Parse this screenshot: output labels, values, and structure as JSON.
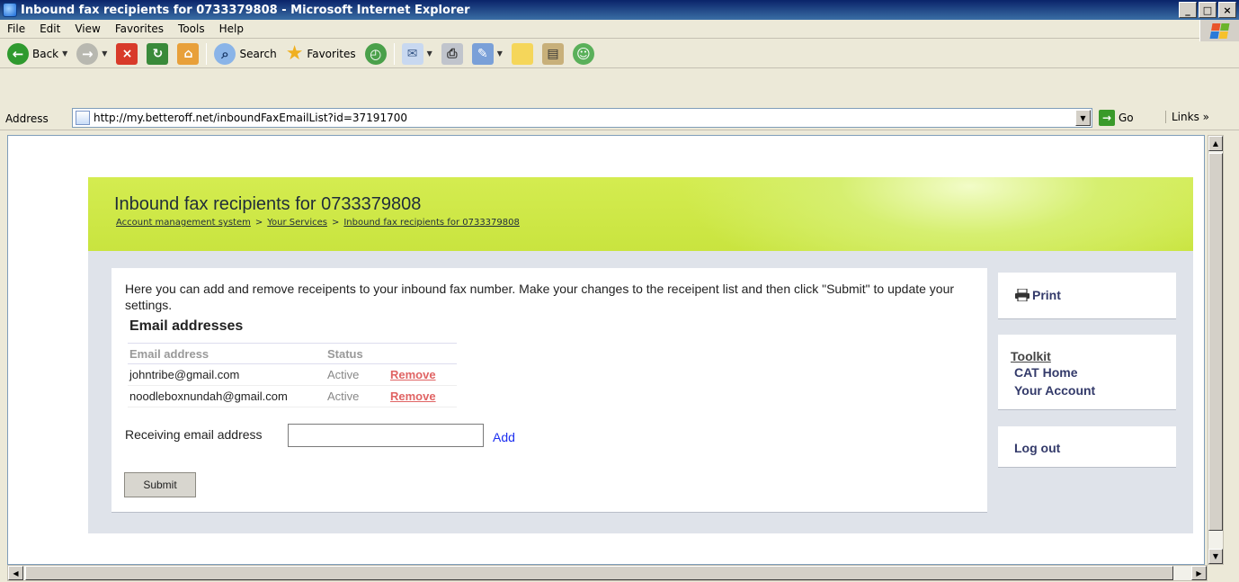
{
  "window": {
    "title": "Inbound fax recipients for 0733379808 - Microsoft Internet Explorer",
    "controls": [
      "_",
      "□",
      "×"
    ]
  },
  "menu": [
    "File",
    "Edit",
    "View",
    "Favorites",
    "Tools",
    "Help"
  ],
  "toolbar": {
    "back_label": "Back",
    "search_label": "Search",
    "favorites_label": "Favorites"
  },
  "address": {
    "label": "Address",
    "url": "http://my.betteroff.net/inboundFaxEmailList?id=37191700",
    "go_label": "Go",
    "links_label": "Links"
  },
  "page": {
    "title": "Inbound fax recipients for 0733379808",
    "breadcrumb": [
      "Account management system",
      "Your Services",
      "Inbound fax recipients for 0733379808"
    ],
    "intro": "Here you can add and remove receipents to your inbound fax number. Make your changes to the receipent list and then click \"Submit\" to update your settings.",
    "section_title": "Email addresses",
    "table": {
      "headers": [
        "Email address",
        "Status"
      ],
      "rows": [
        {
          "email": "johntribe@gmail.com",
          "status": "Active",
          "action": "Remove"
        },
        {
          "email": "noodleboxnundah@gmail.com",
          "status": "Active",
          "action": "Remove"
        }
      ]
    },
    "receiving_label": "Receiving email address",
    "receiving_value": "",
    "add_label": "Add",
    "submit_label": "Submit"
  },
  "sidebar": {
    "print_label": "Print",
    "toolkit_label": "Toolkit",
    "cat_home_label": "CAT Home",
    "your_account_label": "Your Account",
    "logout_label": "Log out"
  },
  "colors": {
    "titlebar": "#0a246a",
    "banner": "#c9e43f",
    "link_blue": "#1b2ef0",
    "remove_red": "#e06464",
    "sidebar_text": "#333a6a"
  }
}
